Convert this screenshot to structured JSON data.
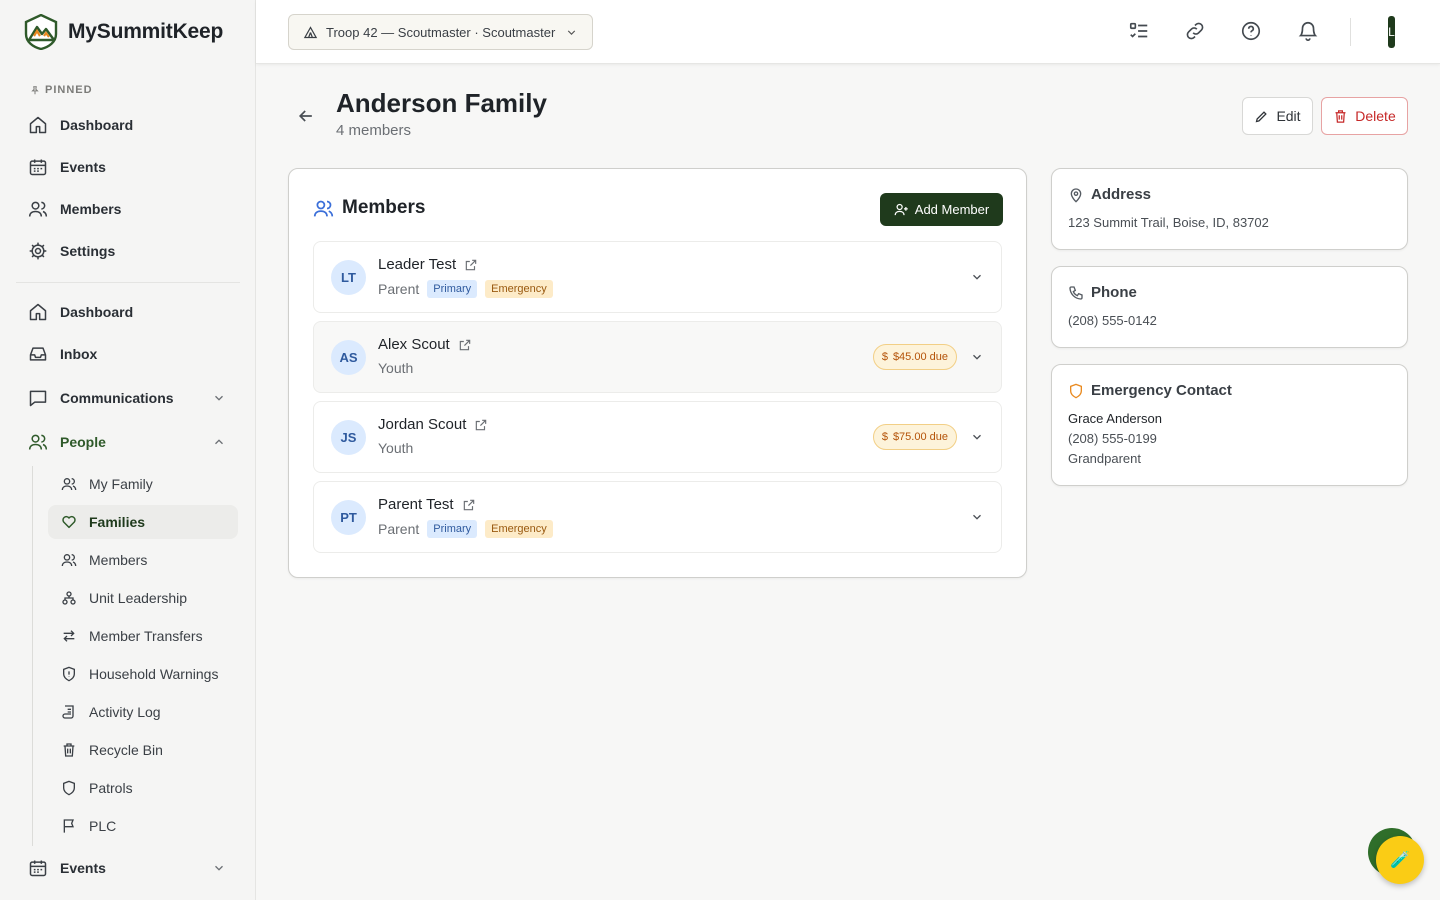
{
  "app": {
    "name": "MySummitKeep"
  },
  "sidebar": {
    "pinned_label": "PINNED",
    "pinned": [
      {
        "label": "Dashboard",
        "icon": "home-icon"
      },
      {
        "label": "Events",
        "icon": "calendar-icon"
      },
      {
        "label": "Members",
        "icon": "users-icon"
      },
      {
        "label": "Settings",
        "icon": "gear-icon"
      }
    ],
    "main": [
      {
        "label": "Dashboard",
        "icon": "home-icon"
      },
      {
        "label": "Inbox",
        "icon": "inbox-icon"
      },
      {
        "label": "Communications",
        "icon": "message-square-icon",
        "expanded": false
      },
      {
        "label": "People",
        "icon": "users-icon",
        "expanded": true
      },
      {
        "label": "Events",
        "icon": "calendar-icon",
        "expanded": false
      }
    ],
    "people_sub": [
      {
        "label": "My Family",
        "icon": "users-icon"
      },
      {
        "label": "Families",
        "icon": "heart-icon",
        "active": true
      },
      {
        "label": "Members",
        "icon": "users-icon"
      },
      {
        "label": "Unit Leadership",
        "icon": "org-chart-icon"
      },
      {
        "label": "Member Transfers",
        "icon": "transfer-arrows-icon"
      },
      {
        "label": "Household Warnings",
        "icon": "shield-alert-icon"
      },
      {
        "label": "Activity Log",
        "icon": "log-scroll-icon"
      },
      {
        "label": "Recycle Bin",
        "icon": "trash-icon"
      },
      {
        "label": "Patrols",
        "icon": "shield-icon"
      },
      {
        "label": "PLC",
        "icon": "flag-icon"
      }
    ]
  },
  "topbar": {
    "unit_selector": "Troop 42 — Scoutmaster · Scoutmaster",
    "icons": [
      "checklist-icon",
      "link-icon",
      "help-circle-icon",
      "bell-icon"
    ],
    "avatar_initial": "L"
  },
  "page": {
    "title": "Anderson Family",
    "subtitle": "4 members",
    "edit_label": "Edit",
    "delete_label": "Delete"
  },
  "members": {
    "heading": "Members",
    "add_label": "Add Member",
    "rows": [
      {
        "initials": "LT",
        "name": "Leader Test",
        "role": "Parent",
        "primary": "Primary",
        "emergency": "Emergency",
        "due": ""
      },
      {
        "initials": "AS",
        "name": "Alex Scout",
        "role": "Youth",
        "primary": "",
        "emergency": "",
        "due": "$45.00 due"
      },
      {
        "initials": "JS",
        "name": "Jordan Scout",
        "role": "Youth",
        "primary": "",
        "emergency": "",
        "due": "$75.00 due"
      },
      {
        "initials": "PT",
        "name": "Parent Test",
        "role": "Parent",
        "primary": "Primary",
        "emergency": "Emergency",
        "due": ""
      }
    ]
  },
  "address": {
    "title": "Address",
    "value": "123 Summit Trail, Boise, ID, 83702"
  },
  "phone": {
    "title": "Phone",
    "value": "(208) 555-0142"
  },
  "emergency_contact": {
    "title": "Emergency Contact",
    "name": "Grace Anderson",
    "phone": "(208) 555-0199",
    "relation": "Grandparent"
  },
  "colors": {
    "brand_green": "#1f3a1c",
    "danger": "#c62828",
    "due_orange": "#b45309",
    "avatar_bg": "#dbeafe",
    "fab_yellow": "#facc15"
  }
}
